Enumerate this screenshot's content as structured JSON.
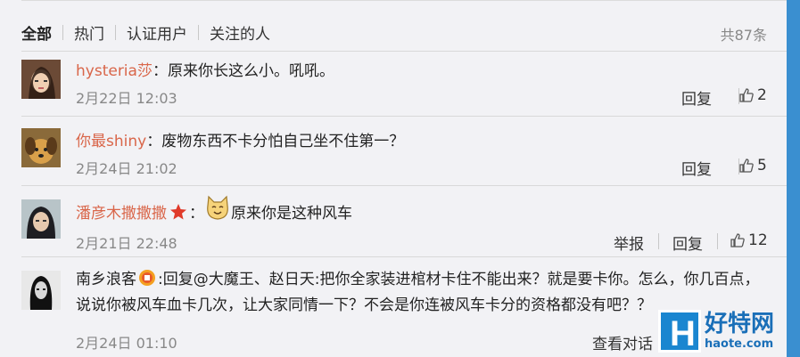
{
  "tabs": [
    {
      "label": "全部"
    },
    {
      "label": "热门"
    },
    {
      "label": "认证用户"
    },
    {
      "label": "关注的人"
    }
  ],
  "total_count": "共87条",
  "comments": [
    {
      "user": "hysteria莎",
      "content": "：原来你长这么小。吼吼。",
      "time": "2月22日 12:03",
      "reply": "回复",
      "likes": "2"
    },
    {
      "user": "你最shiny",
      "content": "：废物东西不卡分怕自己坐不住第一？",
      "time": "2月24日 21:02",
      "reply": "回复",
      "likes": "5"
    },
    {
      "user": "潘彦木撒撒撒",
      "colon": "：",
      "content": "原来你是这种风车",
      "time": "2月21日 22:48",
      "report": "举报",
      "reply": "回复",
      "likes": "12"
    },
    {
      "user": "南乡浪客",
      "prefix": ":回复",
      "mention": "@大魔王、赵日天",
      "content": ":把你全家装进棺材卡住不能出来？就是要卡你。怎么，你几百点，说说你被风车血卡几次，让大家同情一下？不会是你连被风车卡分的资格都没有吧？？",
      "time": "2月24日 01:10",
      "view_conversation": "查看对话"
    }
  ],
  "watermark": {
    "logo_letter": "H",
    "name": "好特网",
    "url": "haote.com"
  },
  "colors": {
    "username": "#d9664a",
    "accent_blue": "#1a86d0"
  }
}
